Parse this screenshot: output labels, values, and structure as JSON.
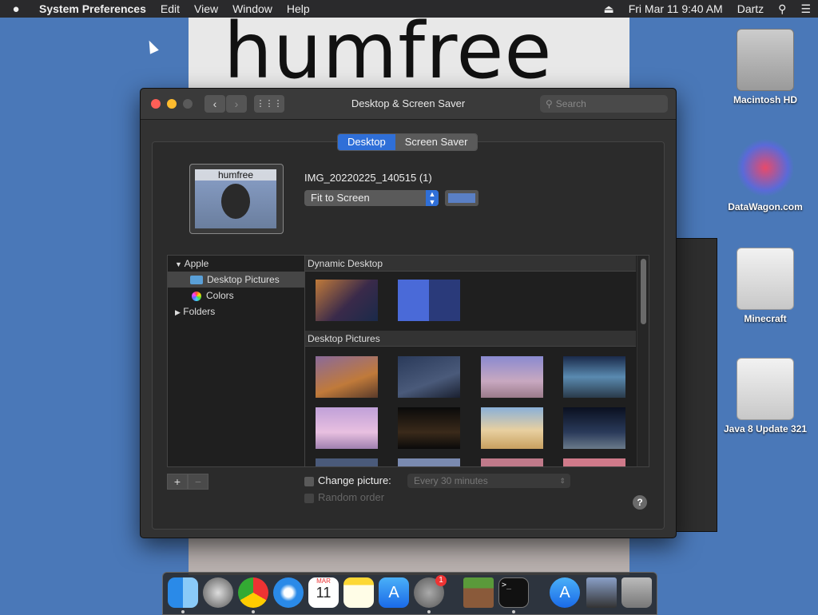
{
  "menubar": {
    "app": "System Preferences",
    "menus": [
      "Edit",
      "View",
      "Window",
      "Help"
    ],
    "datetime": "Fri Mar 11  9:40 AM",
    "user": "Dartz"
  },
  "wallpaper": {
    "text": "humfree"
  },
  "desktop_icons": [
    {
      "label": "Macintosh HD",
      "icon": "hard-drive-icon"
    },
    {
      "label": "DataWagon.com",
      "icon": "datawagon-icon"
    },
    {
      "label": "Minecraft",
      "icon": "disk-image-icon"
    },
    {
      "label": "Java 8 Update 321",
      "icon": "disk-image-icon"
    }
  ],
  "window": {
    "title": "Desktop & Screen Saver",
    "search_placeholder": "Search",
    "tabs": [
      {
        "label": "Desktop",
        "active": true
      },
      {
        "label": "Screen Saver",
        "active": false
      }
    ],
    "preview_label": "humfree",
    "filename": "IMG_20220225_140515 (1)",
    "fit_option": "Fit to Screen",
    "swatch_color": "#5a7fc4",
    "sidebar": [
      {
        "label": "Apple",
        "level": 0,
        "expanded": true,
        "selected": false
      },
      {
        "label": "Desktop Pictures",
        "level": 1,
        "selected": true,
        "icon": "folder-icon"
      },
      {
        "label": "Colors",
        "level": 1,
        "selected": false,
        "icon": "color-wheel-icon"
      },
      {
        "label": "Folders",
        "level": 0,
        "expanded": false,
        "selected": false
      }
    ],
    "sections": [
      {
        "title": "Dynamic Desktop",
        "thumbs": 2
      },
      {
        "title": "Desktop Pictures",
        "thumbs": 12
      }
    ],
    "change_picture_label": "Change picture:",
    "interval": "Every 30 minutes",
    "random_order_label": "Random order",
    "help_label": "?",
    "add_label": "+",
    "remove_label": "−"
  },
  "dock": {
    "apps": [
      "Finder",
      "Launchpad",
      "Chrome",
      "Safari",
      "Calendar",
      "Notes",
      "App Store",
      "System Preferences",
      "Minecraft",
      "Terminal",
      "App Store",
      "Preview",
      "Trash"
    ],
    "calendar_month": "MAR",
    "calendar_day": "11",
    "sysprefs_badge": "1"
  }
}
